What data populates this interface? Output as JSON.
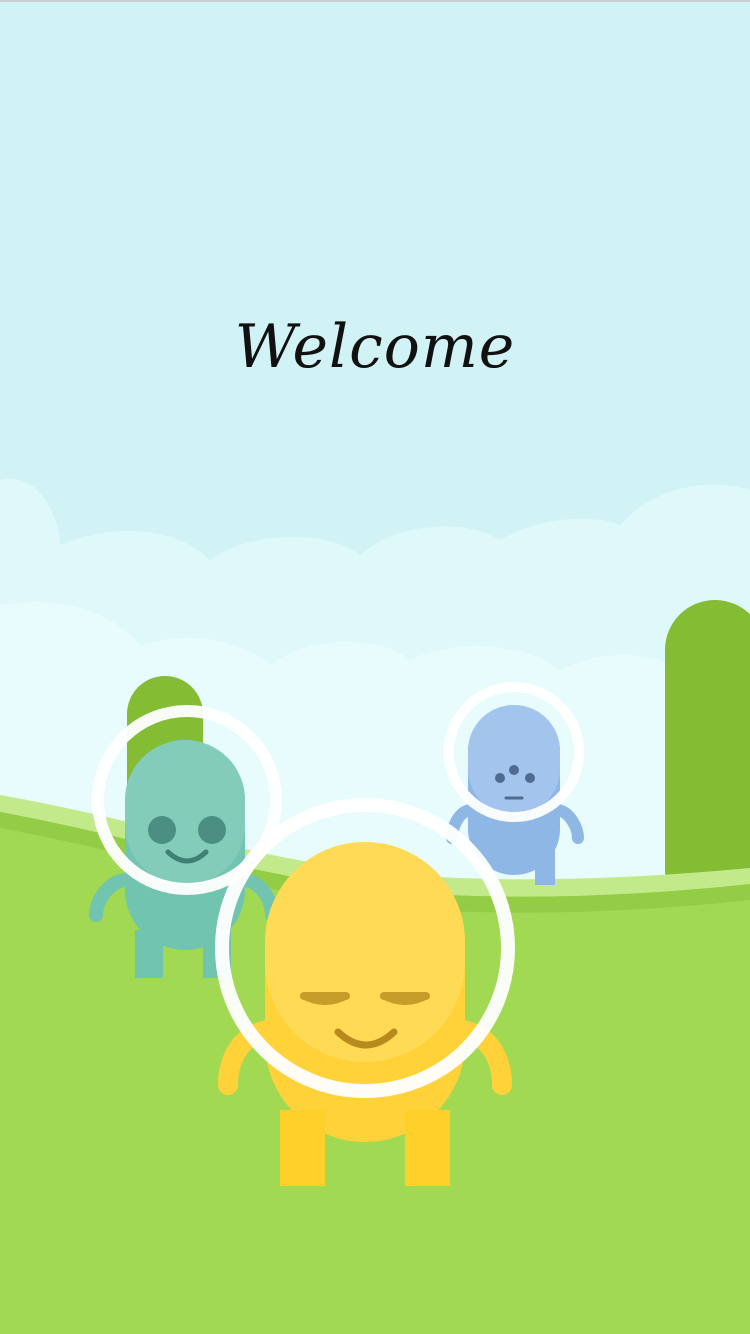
{
  "welcome": {
    "title": "Welcome"
  },
  "scene": {
    "sky_color": "#d1f3f5",
    "cloud_color": "#e5fbfd",
    "ground_color": "#a2d952",
    "bush_color": "#84bc33",
    "characters": [
      {
        "name": "teal-astronaut",
        "color": "#70c4b0"
      },
      {
        "name": "blue-astronaut",
        "color": "#8fb7e6"
      },
      {
        "name": "yellow-astronaut",
        "color": "#ffd23a"
      }
    ]
  }
}
